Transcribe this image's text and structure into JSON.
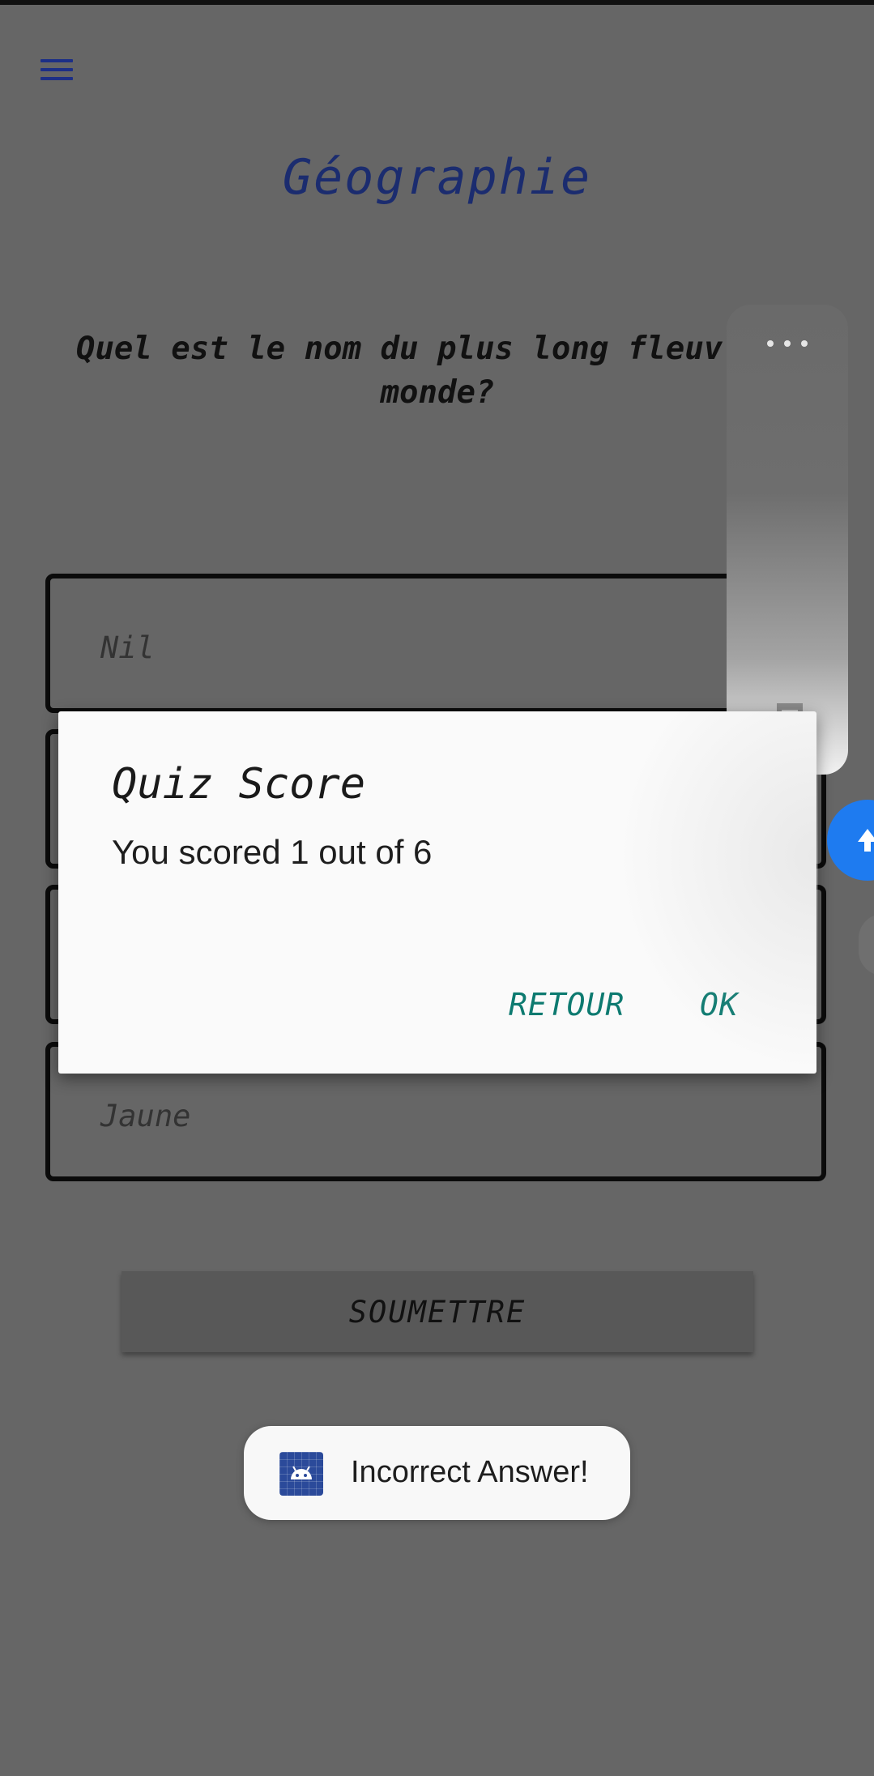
{
  "header": {
    "menu_icon": "hamburger-menu-icon",
    "accent_color": "#1b2c6f"
  },
  "quiz": {
    "title": "Géographie",
    "question": "Quel est le nom du plus long fleuv     monde?",
    "options": [
      {
        "label": "Nil"
      },
      {
        "label": ""
      },
      {
        "label": ""
      },
      {
        "label": "Jaune"
      }
    ],
    "submit_label": "SOUMETTRE"
  },
  "dialog": {
    "title": "Quiz Score",
    "message": "You scored 1 out of 6",
    "buttons": {
      "back": "RETOUR",
      "ok": "OK"
    },
    "button_color": "#0d7a70"
  },
  "toast": {
    "message": "Incorrect Answer!",
    "icon": "android-app-icon"
  },
  "overlay": {
    "more_icon": "more-dots-icon",
    "music_icon": "music-note-icon",
    "bubble_color": "#1e7bf0"
  }
}
